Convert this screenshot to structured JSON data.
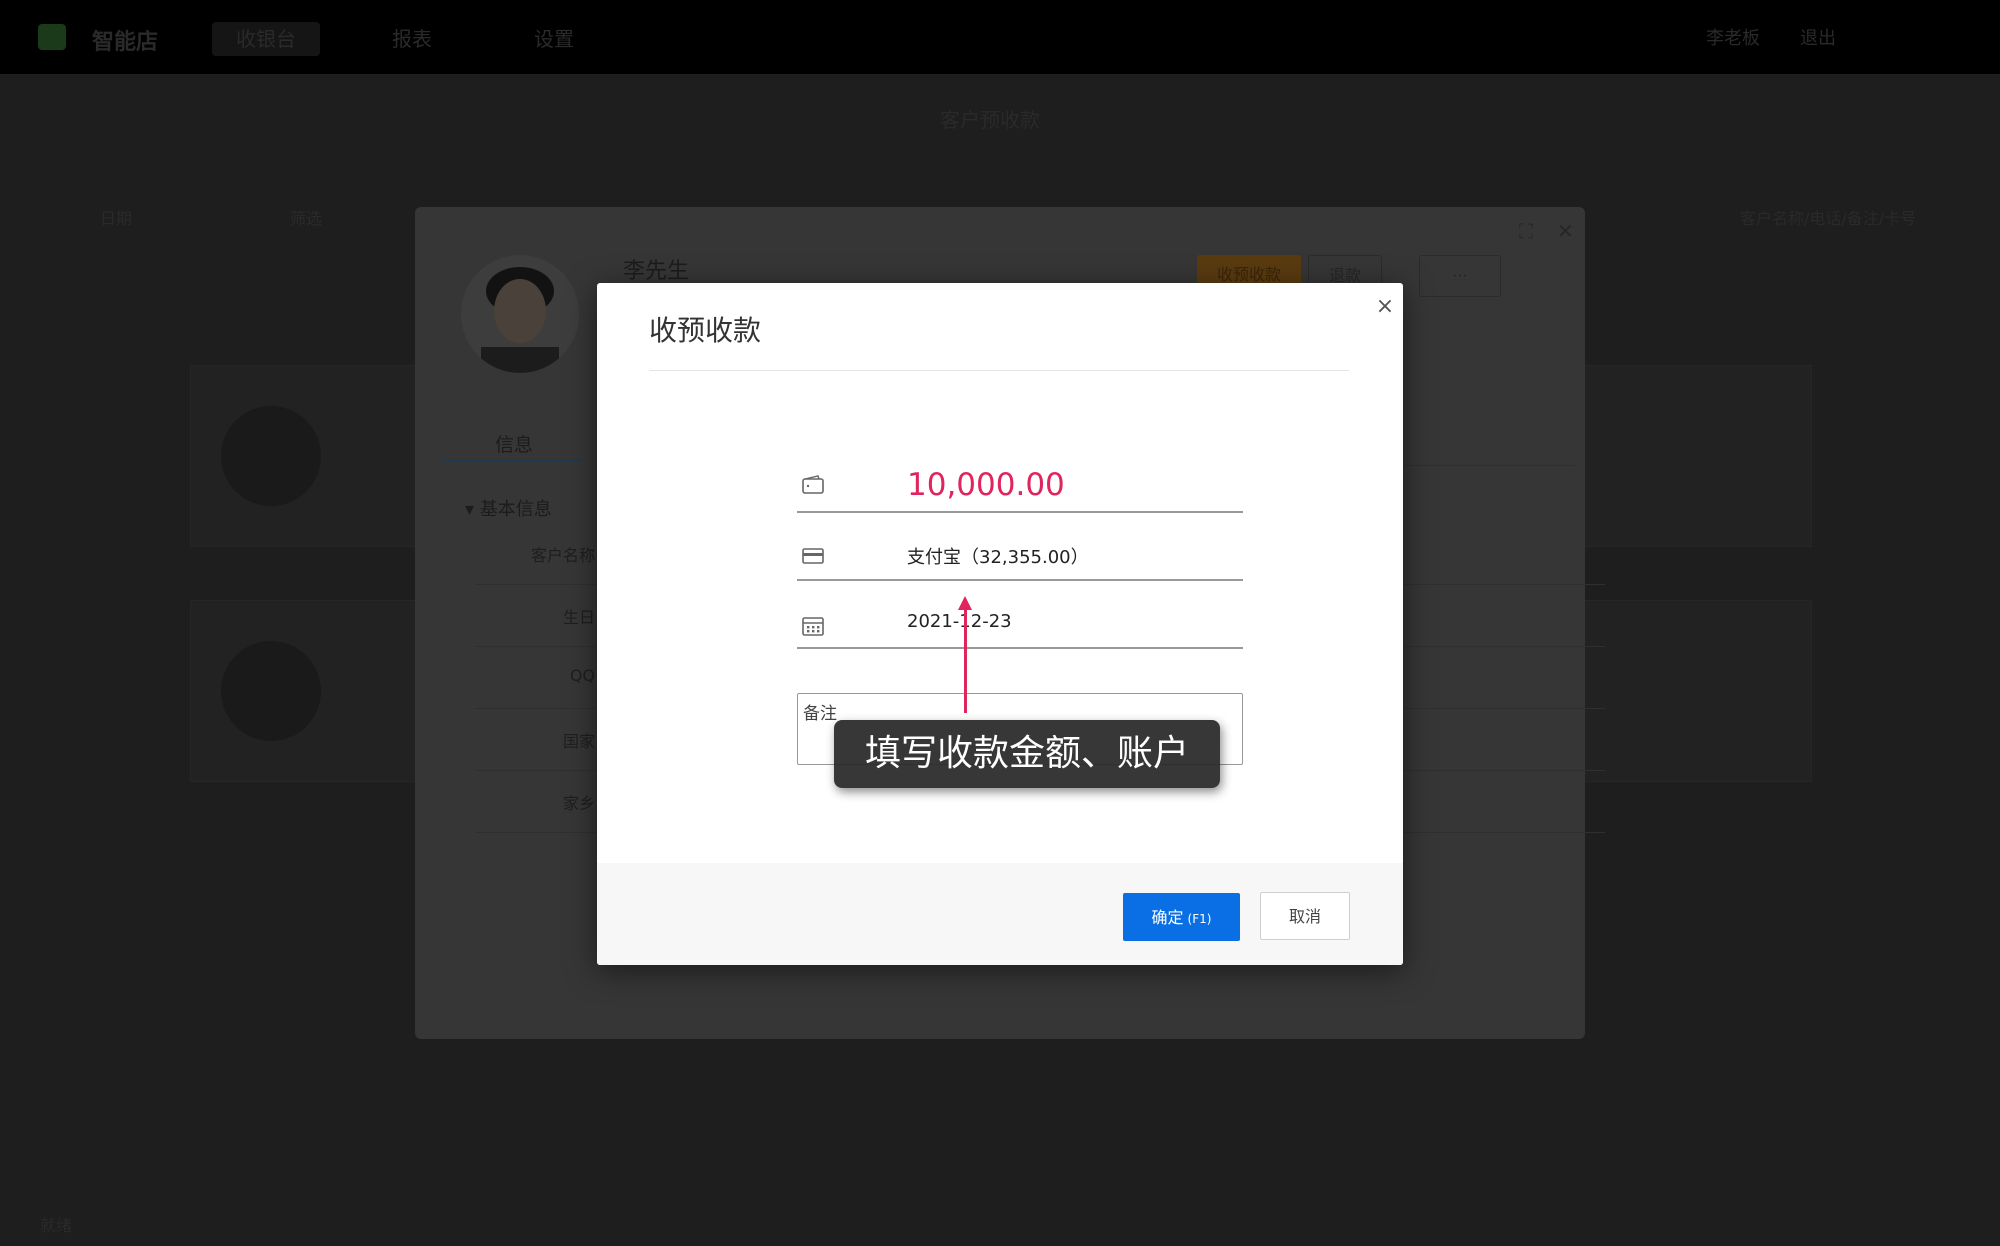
{
  "background": {
    "app_name": "智能店",
    "nav": [
      "收银台",
      "报表",
      "设置"
    ],
    "top_right": [
      "李老板",
      "退出"
    ],
    "page_title": "客户预收款",
    "filters": [
      "日期",
      "筛选"
    ],
    "search_hint": "客户名称/电话/备注/卡号",
    "status": "就绪"
  },
  "customer_panel": {
    "name": "李先生",
    "actions": [
      "收预收款",
      "退款",
      "···"
    ],
    "tab_info": "信息",
    "section_title": "基本信息",
    "fields": [
      "客户名称",
      "生日",
      "QQ",
      "国家",
      "家乡"
    ]
  },
  "modal": {
    "title": "收预收款",
    "close": "×",
    "amount": "10,000.00",
    "account": "支付宝（32,355.00）",
    "date": "2021-12-23",
    "notes_placeholder": "备注",
    "confirm_label": "确定",
    "confirm_shortcut": "(F1)",
    "cancel_label": "取消"
  },
  "annotation": {
    "text": "填写收款金额、账户"
  },
  "colors": {
    "accent_blue": "#0a6fe4",
    "amount_red": "#e0245e",
    "overlay": "#1e1e1e"
  },
  "icons": {
    "amount": "wallet-icon",
    "account": "credit-card-icon",
    "date": "calendar-icon",
    "close": "close-icon",
    "maximize": "maximize-icon"
  }
}
